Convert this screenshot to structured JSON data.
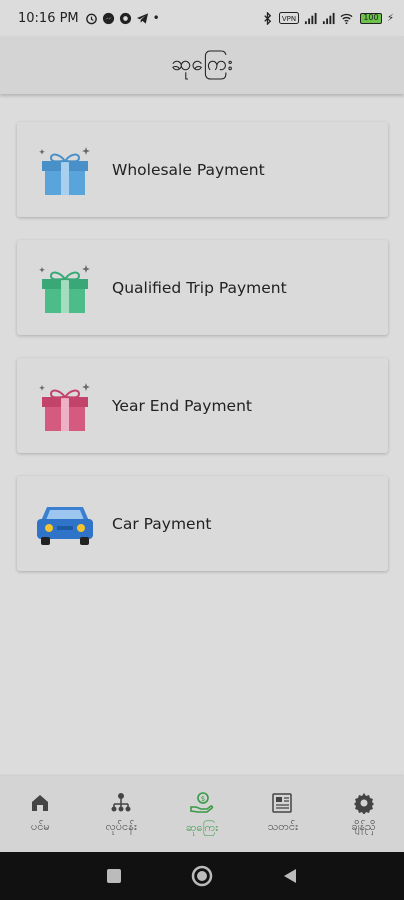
{
  "status_bar": {
    "time": "10:16 PM",
    "battery_level": "100"
  },
  "header": {
    "title": "ဆုကြေး"
  },
  "cards": [
    {
      "label": "Wholesale Payment",
      "icon": "gift-blue-icon",
      "color": "#4a90c8"
    },
    {
      "label": "Qualified Trip Payment",
      "icon": "gift-green-icon",
      "color": "#3aa876"
    },
    {
      "label": "Year End Payment",
      "icon": "gift-red-icon",
      "color": "#c2446a"
    },
    {
      "label": "Car Payment",
      "icon": "car-icon",
      "color": "#2f74c8"
    }
  ],
  "bottom_nav": {
    "items": [
      {
        "label": "ပင်မ",
        "icon": "home-icon"
      },
      {
        "label": "လုပ်ငန်း",
        "icon": "org-icon"
      },
      {
        "label": "ဆုကြေး",
        "icon": "reward-icon",
        "active": true
      },
      {
        "label": "သတင်း",
        "icon": "news-icon"
      },
      {
        "label": "ချိန်ညှိ",
        "icon": "gear-icon"
      }
    ],
    "active_color": "#3a9a46"
  }
}
